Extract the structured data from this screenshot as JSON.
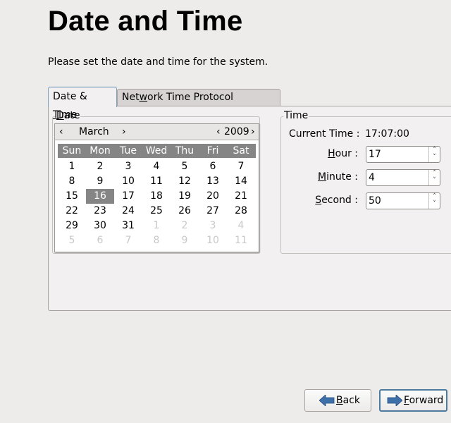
{
  "page": {
    "title": "Date and Time",
    "subtitle": "Please set the date and time for the system."
  },
  "tabs": [
    {
      "label_pre": "Date & ",
      "label_mnemonic": "T",
      "label_post": "ime",
      "active": true
    },
    {
      "label_pre": "Net",
      "label_mnemonic": "w",
      "label_post": "ork Time Protocol",
      "active": false
    }
  ],
  "date_frame": {
    "label_mnemonic": "D",
    "label_rest": "ate",
    "calendar": {
      "month": "March",
      "year": "2009",
      "prev_month": "‹",
      "next_month": "›",
      "prev_year": "‹",
      "next_year": "›",
      "weekdays": [
        "Sun",
        "Mon",
        "Tue",
        "Wed",
        "Thu",
        "Fri",
        "Sat"
      ],
      "selected_day": "16",
      "weeks": [
        [
          {
            "d": "1"
          },
          {
            "d": "2"
          },
          {
            "d": "3"
          },
          {
            "d": "4"
          },
          {
            "d": "5"
          },
          {
            "d": "6"
          },
          {
            "d": "7"
          }
        ],
        [
          {
            "d": "8"
          },
          {
            "d": "9"
          },
          {
            "d": "10"
          },
          {
            "d": "11"
          },
          {
            "d": "12"
          },
          {
            "d": "13"
          },
          {
            "d": "14"
          }
        ],
        [
          {
            "d": "15"
          },
          {
            "d": "16",
            "sel": true
          },
          {
            "d": "17"
          },
          {
            "d": "18"
          },
          {
            "d": "19"
          },
          {
            "d": "20"
          },
          {
            "d": "21"
          }
        ],
        [
          {
            "d": "22"
          },
          {
            "d": "23"
          },
          {
            "d": "24"
          },
          {
            "d": "25"
          },
          {
            "d": "26"
          },
          {
            "d": "27"
          },
          {
            "d": "28"
          }
        ],
        [
          {
            "d": "29"
          },
          {
            "d": "30"
          },
          {
            "d": "31"
          },
          {
            "d": "1",
            "other": true
          },
          {
            "d": "2",
            "other": true
          },
          {
            "d": "3",
            "other": true
          },
          {
            "d": "4",
            "other": true
          }
        ],
        [
          {
            "d": "5",
            "other": true
          },
          {
            "d": "6",
            "other": true
          },
          {
            "d": "7",
            "other": true
          },
          {
            "d": "8",
            "other": true
          },
          {
            "d": "9",
            "other": true
          },
          {
            "d": "10",
            "other": true
          },
          {
            "d": "11",
            "other": true
          }
        ]
      ]
    }
  },
  "time_frame": {
    "label": "Time",
    "current_time_label": "Current Time :",
    "current_time_value": "17:07:00",
    "hour": {
      "label_mnemonic": "H",
      "label_rest": "our :",
      "value": "17"
    },
    "minute": {
      "label_mnemonic": "M",
      "label_rest": "inute :",
      "value": "4"
    },
    "second": {
      "label_mnemonic": "S",
      "label_rest": "econd :",
      "value": "50"
    },
    "spin_up": "˄",
    "spin_down": "˅"
  },
  "buttons": {
    "back": {
      "mnemonic": "B",
      "rest": "ack"
    },
    "forward": {
      "mnemonic": "F",
      "rest": "orward"
    }
  },
  "colors": {
    "arrow_blue": "#3d6fa8",
    "selection_gray": "#858585"
  }
}
